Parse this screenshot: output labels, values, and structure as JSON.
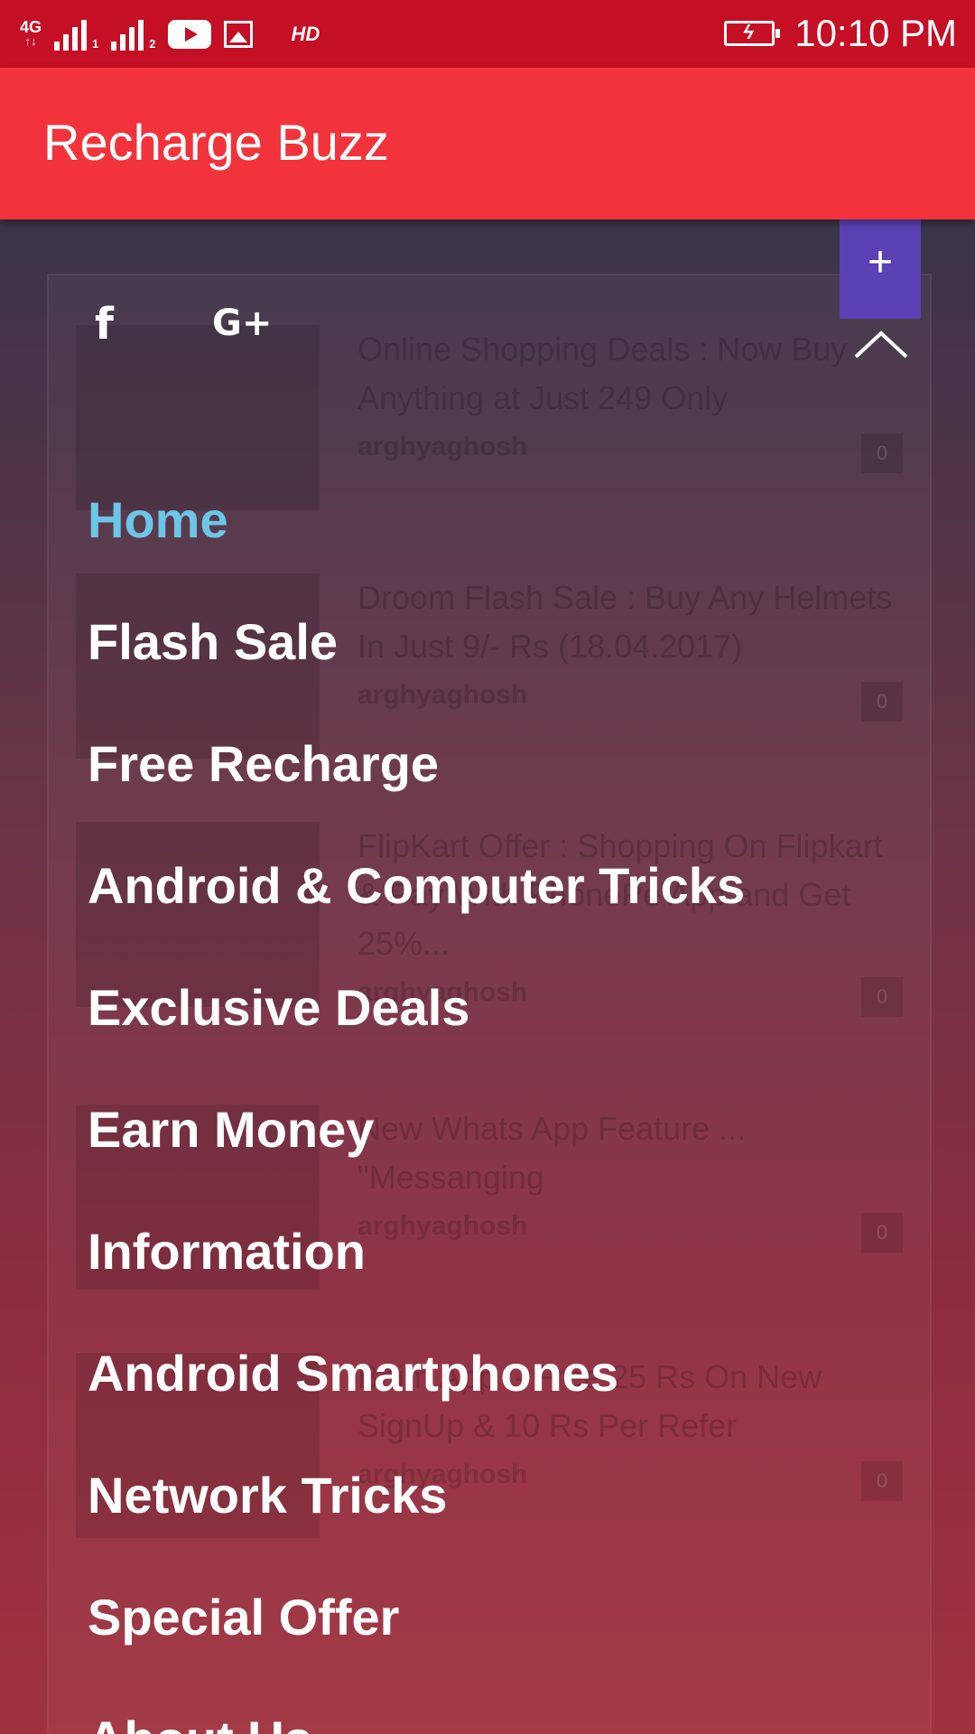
{
  "status_bar": {
    "network": "4G",
    "sim1": "1",
    "sim2": "2",
    "hd": "HD",
    "time": "10:10 PM",
    "icons": [
      "network-4g-icon",
      "signal-sim1-icon",
      "signal-sim2-icon",
      "youtube-icon",
      "image-icon",
      "hd-icon",
      "battery-charging-icon"
    ]
  },
  "app_bar": {
    "title": "Recharge Buzz",
    "color": "#f2333b"
  },
  "drawer": {
    "social": {
      "facebook": "f",
      "google_plus": "G+"
    },
    "fab_label": "+",
    "menu": [
      {
        "label": "Home",
        "active": true
      },
      {
        "label": "Flash Sale",
        "active": false
      },
      {
        "label": "Free Recharge",
        "active": false
      },
      {
        "label": "Android & Computer Tricks",
        "active": false
      },
      {
        "label": "Exclusive Deals",
        "active": false
      },
      {
        "label": "Earn Money",
        "active": false
      },
      {
        "label": "Information",
        "active": false
      },
      {
        "label": "Android Smartphones",
        "active": false
      },
      {
        "label": "Network Tricks",
        "active": false
      },
      {
        "label": "Special Offer",
        "active": false
      },
      {
        "label": "About Us",
        "active": false
      }
    ],
    "active_color": "#6cc6e8"
  },
  "background_posts": [
    {
      "title": "Online Shopping Deals : Now Buy Anything at Just 249 Only",
      "author": "arghyaghosh",
      "comments": "0"
    },
    {
      "title": "Droom Flash Sale : Buy Any Helmets In Just 9/- Rs (18.04.2017)",
      "author": "arghyaghosh",
      "comments": "0"
    },
    {
      "title": "FlipKart Offer : Shopping On Flipkart & Pay With PhonePe App and Get 25%...",
      "author": "arghyaghosh",
      "comments": "0"
    },
    {
      "title": "New Whats App Feature ... \"Messanging",
      "author": "arghyaghosh",
      "comments": "0"
    },
    {
      "title": "Bhim App :- Free 25 Rs On New SignUp & 10 Rs Per Refer",
      "author": "arghyaghosh",
      "comments": "0"
    }
  ]
}
